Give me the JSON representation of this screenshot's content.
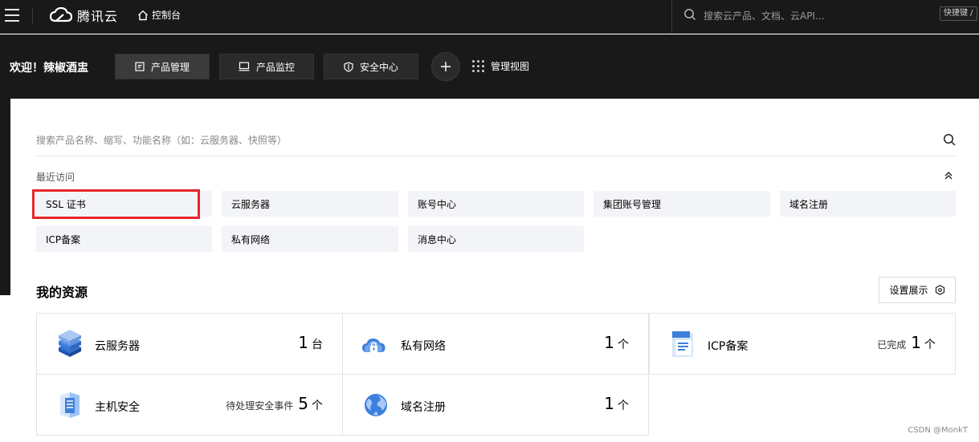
{
  "header": {
    "brand": "腾讯云",
    "console": "控制台",
    "search_placeholder": "搜索云产品、文档、云API...",
    "shortcut": "快捷键 /"
  },
  "subnav": {
    "welcome": "欢迎！辣椒酒盅",
    "tabs": [
      {
        "label": "产品管理",
        "icon": "document-icon",
        "active": true
      },
      {
        "label": "产品监控",
        "icon": "monitor-icon",
        "active": false
      },
      {
        "label": "安全中心",
        "icon": "shield-icon",
        "active": false
      }
    ],
    "add_icon": "plus-icon",
    "manage_view": "管理视图"
  },
  "search": {
    "placeholder": "搜索产品名称、缩写、功能名称（如：云服务器、快照等）"
  },
  "recent": {
    "label": "最近访问",
    "items": [
      "SSL 证书",
      "云服务器",
      "账号中心",
      "集团账号管理",
      "域名注册",
      "ICP备案",
      "私有网络",
      "消息中心"
    ]
  },
  "resources": {
    "title": "我的资源",
    "settings_label": "设置展示",
    "cards": [
      {
        "name": "云服务器",
        "note": "",
        "count": "1",
        "unit": "台",
        "icon": "server-icon"
      },
      {
        "name": "私有网络",
        "note": "",
        "count": "1",
        "unit": "个",
        "icon": "cloud-lock-icon"
      },
      {
        "name": "ICP备案",
        "note": "已完成",
        "count": "1",
        "unit": "个",
        "icon": "document-icon"
      },
      {
        "name": "主机安全",
        "note": "待处理安全事件",
        "count": "5",
        "unit": "个",
        "icon": "host-security-icon"
      },
      {
        "name": "域名注册",
        "note": "",
        "count": "1",
        "unit": "个",
        "icon": "globe-icon"
      }
    ]
  },
  "watermark": "CSDN @MonkT",
  "colors": {
    "dark_bg": "#191919",
    "highlight": "#e8262b",
    "chip_bg": "#f3f4f7"
  }
}
